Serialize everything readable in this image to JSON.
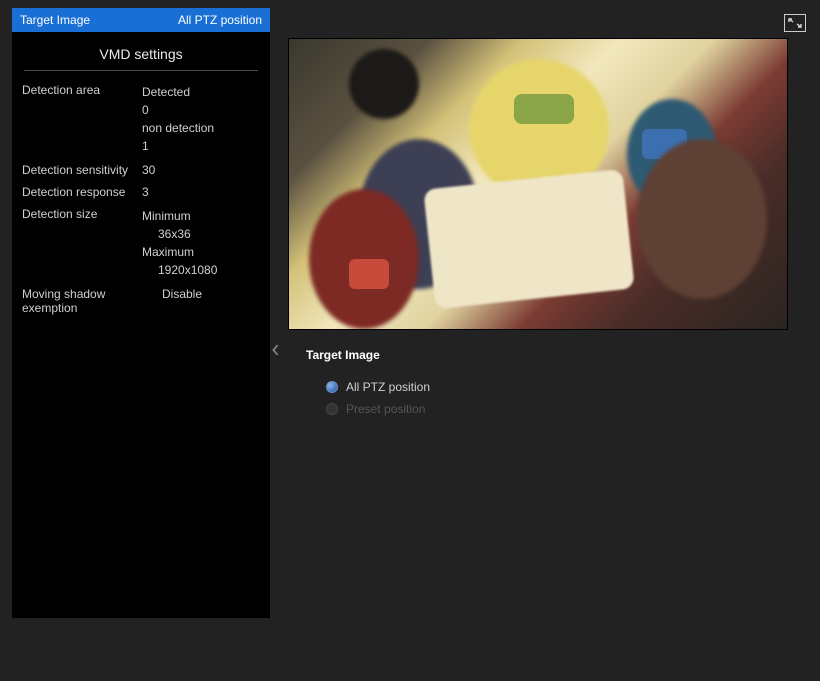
{
  "sidebar": {
    "header": {
      "left": "Target Image",
      "right": "All PTZ position"
    },
    "section_title": "VMD settings",
    "detection_area": {
      "label": "Detection area",
      "detected_label": "Detected",
      "detected_value": "0",
      "nondetection_label": "non detection",
      "nondetection_value": "1"
    },
    "detection_sensitivity": {
      "label": "Detection sensitivity",
      "value": "30"
    },
    "detection_response": {
      "label": "Detection response",
      "value": "3"
    },
    "detection_size": {
      "label": "Detection size",
      "min_label": "Minimum",
      "min_value": "36x36",
      "max_label": "Maximum",
      "max_value": "1920x1080"
    },
    "moving_shadow": {
      "label": "Moving shadow exemption",
      "value": "Disable"
    }
  },
  "main": {
    "form_title": "Target Image",
    "options": {
      "all_ptz": "All PTZ position",
      "preset": "Preset position"
    }
  }
}
